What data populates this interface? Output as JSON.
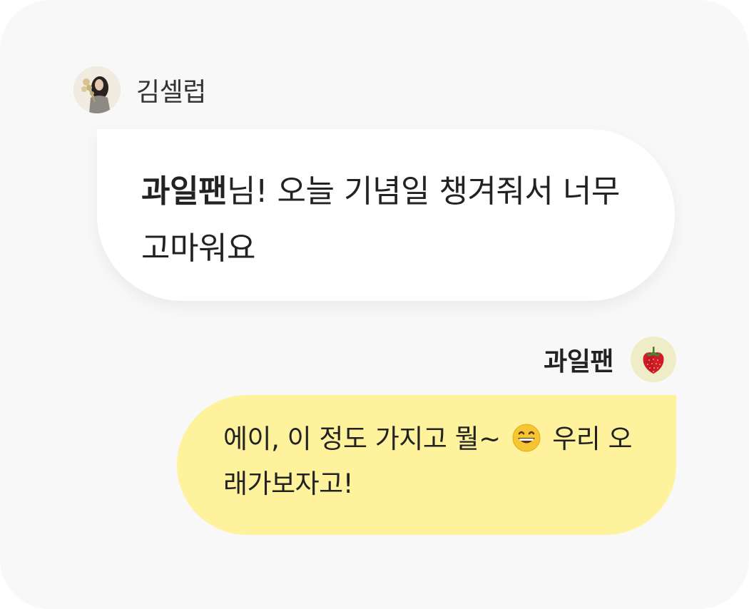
{
  "chat": {
    "incoming": {
      "sender_name": "김셀럽",
      "message_highlight": "과일팬",
      "message_text": "님! 오늘 기념일 챙겨줘서 너무 고마워요"
    },
    "outgoing": {
      "sender_name": "과일팬",
      "avatar_icon": "strawberry-icon",
      "message_before_emoji": "에이, 이 정도 가지고 뭘~ ",
      "emoji_icon": "grinning-face-icon",
      "message_after_emoji": " 우리 오래가보자고!"
    }
  },
  "colors": {
    "background": "#f8f8f8",
    "incoming_bubble": "#ffffff",
    "outgoing_bubble": "#fff29c",
    "text": "#222222"
  }
}
